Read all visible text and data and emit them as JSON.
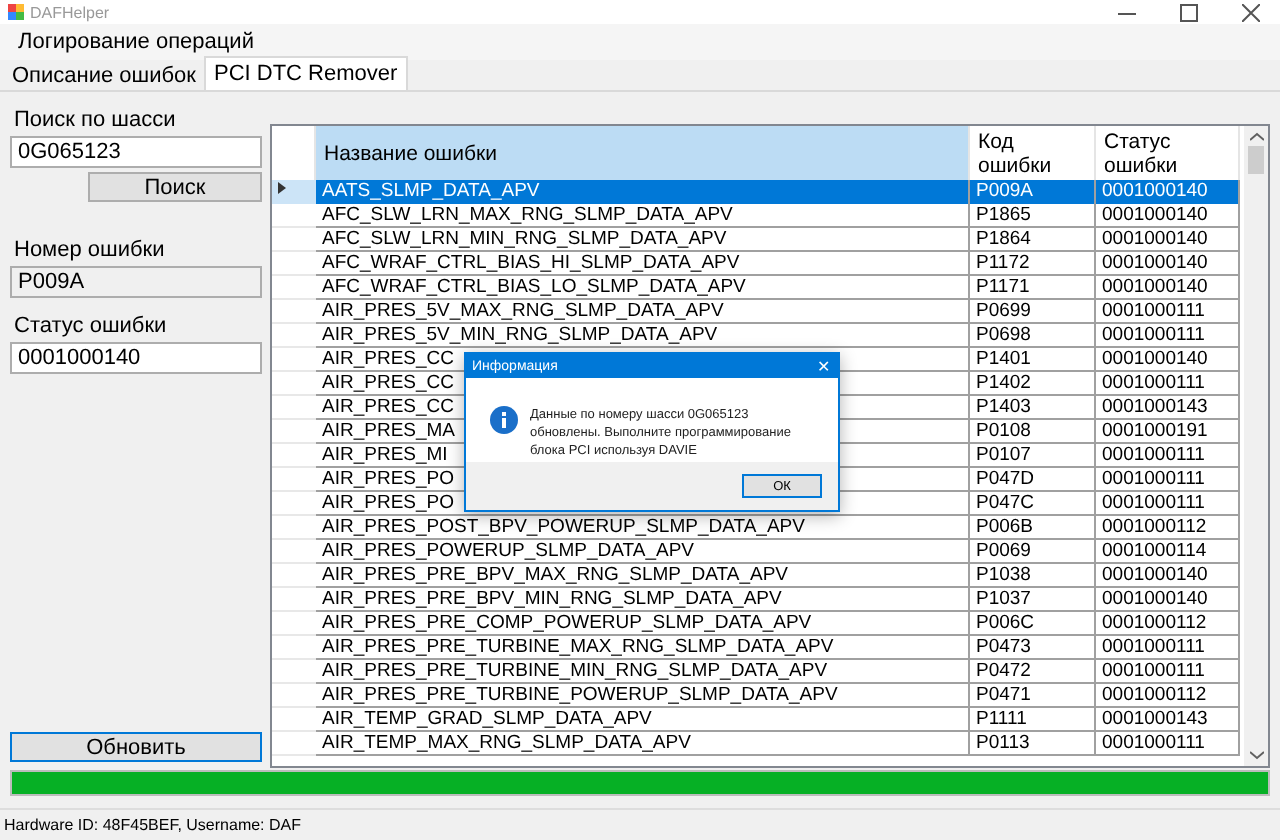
{
  "window": {
    "title": "DAFHelper"
  },
  "menu": [
    {
      "label": "Логирование операций"
    }
  ],
  "tabs": [
    {
      "label": "Описание ошибок",
      "selected": false
    },
    {
      "label": "PCI DTC Remover",
      "selected": true
    }
  ],
  "left": {
    "search_label": "Поиск по шасси",
    "search_value": "0G065123",
    "search_button": "Поиск",
    "code_label": "Номер ошибки",
    "code_value": "P009A",
    "status_label": "Статус ошибки",
    "status_value": "0001000140",
    "refresh_button": "Обновить"
  },
  "table": {
    "columns": [
      "Название ошибки",
      "Код ошибки",
      "Статус ошибки"
    ],
    "rows": [
      {
        "name": "AATS_SLMP_DATA_APV",
        "code": "P009A",
        "status": "0001000140",
        "selected": true
      },
      {
        "name": "AFC_SLW_LRN_MAX_RNG_SLMP_DATA_APV",
        "code": "P1865",
        "status": "0001000140",
        "selected": false
      },
      {
        "name": "AFC_SLW_LRN_MIN_RNG_SLMP_DATA_APV",
        "code": "P1864",
        "status": "0001000140",
        "selected": false
      },
      {
        "name": "AFC_WRAF_CTRL_BIAS_HI_SLMP_DATA_APV",
        "code": "P1172",
        "status": "0001000140",
        "selected": false
      },
      {
        "name": "AFC_WRAF_CTRL_BIAS_LO_SLMP_DATA_APV",
        "code": "P1171",
        "status": "0001000140",
        "selected": false
      },
      {
        "name": "AIR_PRES_5V_MAX_RNG_SLMP_DATA_APV",
        "code": "P0699",
        "status": "0001000111",
        "selected": false
      },
      {
        "name": "AIR_PRES_5V_MIN_RNG_SLMP_DATA_APV",
        "code": "P0698",
        "status": "0001000111",
        "selected": false
      },
      {
        "name": "AIR_PRES_CC",
        "code": "P1401",
        "status": "0001000140",
        "selected": false
      },
      {
        "name": "AIR_PRES_CC",
        "code": "P1402",
        "status": "0001000111",
        "selected": false
      },
      {
        "name": "AIR_PRES_CC",
        "code": "P1403",
        "status": "0001000143",
        "selected": false
      },
      {
        "name": "AIR_PRES_MA",
        "code": "P0108",
        "status": "0001000191",
        "selected": false
      },
      {
        "name": "AIR_PRES_MI",
        "code": "P0107",
        "status": "0001000111",
        "selected": false
      },
      {
        "name": "AIR_PRES_PO",
        "code": "P047D",
        "status": "0001000111",
        "selected": false
      },
      {
        "name": "AIR_PRES_PO",
        "code": "P047C",
        "status": "0001000111",
        "selected": false
      },
      {
        "name": "AIR_PRES_POST_BPV_POWERUP_SLMP_DATA_APV",
        "code": "P006B",
        "status": "0001000112",
        "selected": false
      },
      {
        "name": "AIR_PRES_POWERUP_SLMP_DATA_APV",
        "code": "P0069",
        "status": "0001000114",
        "selected": false
      },
      {
        "name": "AIR_PRES_PRE_BPV_MAX_RNG_SLMP_DATA_APV",
        "code": "P1038",
        "status": "0001000140",
        "selected": false
      },
      {
        "name": "AIR_PRES_PRE_BPV_MIN_RNG_SLMP_DATA_APV",
        "code": "P1037",
        "status": "0001000140",
        "selected": false
      },
      {
        "name": "AIR_PRES_PRE_COMP_POWERUP_SLMP_DATA_APV",
        "code": "P006C",
        "status": "0001000112",
        "selected": false
      },
      {
        "name": "AIR_PRES_PRE_TURBINE_MAX_RNG_SLMP_DATA_APV",
        "code": "P0473",
        "status": "0001000111",
        "selected": false
      },
      {
        "name": "AIR_PRES_PRE_TURBINE_MIN_RNG_SLMP_DATA_APV",
        "code": "P0472",
        "status": "0001000111",
        "selected": false
      },
      {
        "name": "AIR_PRES_PRE_TURBINE_POWERUP_SLMP_DATA_APV",
        "code": "P0471",
        "status": "0001000112",
        "selected": false
      },
      {
        "name": "AIR_TEMP_GRAD_SLMP_DATA_APV",
        "code": "P1111",
        "status": "0001000143",
        "selected": false
      },
      {
        "name": "AIR_TEMP_MAX_RNG_SLMP_DATA_APV",
        "code": "P0113",
        "status": "0001000111",
        "selected": false
      }
    ]
  },
  "progress": {
    "level": 1
  },
  "dialog": {
    "title": "Информация",
    "close": "✕",
    "message": "Данные по номеру шасси 0G065123 обновлены. Выполните программирование блока PCI используя DAVIE",
    "button": "ОК"
  },
  "status_bar": "Hardware ID: 48F45BEF, Username: DAF"
}
